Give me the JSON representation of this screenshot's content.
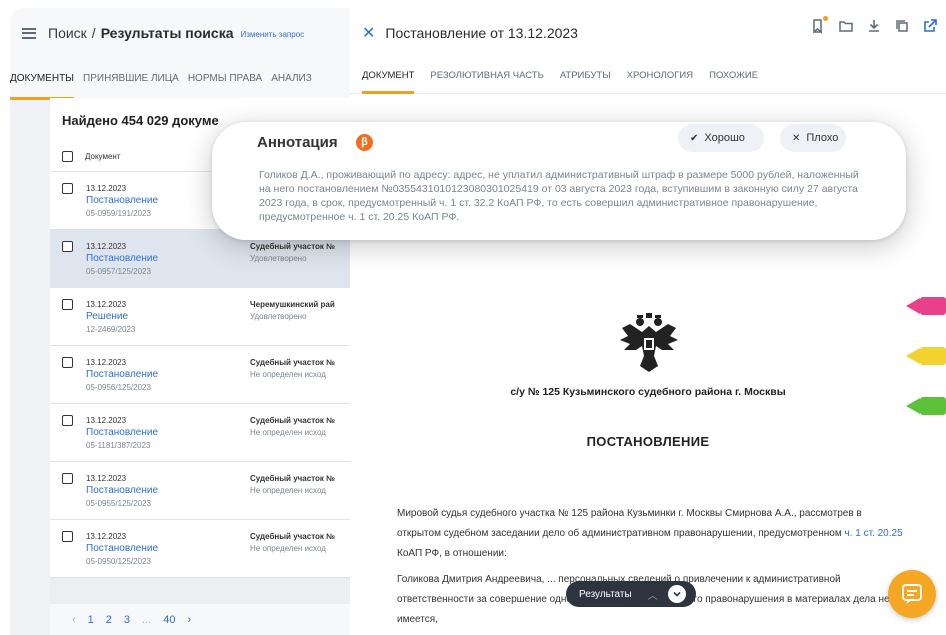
{
  "left": {
    "breadcrumb_root": "Поиск",
    "breadcrumb_sep": "/",
    "breadcrumb_current": "Результаты поиска",
    "change_query": "Изменить запрос",
    "tabs": [
      {
        "label": "ДОКУМЕНТЫ",
        "active": true
      },
      {
        "label": "ПРИНЯВШИЕ ЛИЦА",
        "active": false
      },
      {
        "label": "НОРМЫ ПРАВА",
        "active": false
      },
      {
        "label": "АНАЛИЗ",
        "active": false
      }
    ],
    "found": "Найдено 454 029 докуме",
    "column_document": "Документ",
    "rows": [
      {
        "date": "13.12.2023",
        "type": "Постановление",
        "number": "05-0959/191/2023",
        "court": "",
        "outcome": ""
      },
      {
        "date": "13.12.2023",
        "type": "Постановление",
        "number": "05-0957/125/2023",
        "court": "Судебный участок №",
        "outcome": "Удовлетворено"
      },
      {
        "date": "13.12.2023",
        "type": "Решение",
        "number": "12-2469/2023",
        "court": "Черемушкинский рай",
        "outcome": "Удовлетворено"
      },
      {
        "date": "13.12.2023",
        "type": "Постановление",
        "number": "05-0956/125/2023",
        "court": "Судебный участок №",
        "outcome": "Не определен исход"
      },
      {
        "date": "13.12.2023",
        "type": "Постановление",
        "number": "05-1181/387/2023",
        "court": "Судебный участок №",
        "outcome": "Не определен исход"
      },
      {
        "date": "13.12.2023",
        "type": "Постановление",
        "number": "05-0955/125/2023",
        "court": "Судебный участок №",
        "outcome": "Не определен исход"
      },
      {
        "date": "13.12.2023",
        "type": "Постановление",
        "number": "05-0950/125/2023",
        "court": "Судебный участок №",
        "outcome": "Не определен исход"
      }
    ],
    "pager": {
      "prev": "‹",
      "pages": [
        "1",
        "2",
        "3"
      ],
      "ellipsis": "...",
      "last": "40",
      "next": "›"
    }
  },
  "right": {
    "close_glyph": "✕",
    "title": "Постановление от 13.12.2023",
    "tabs": [
      {
        "label": "ДОКУМЕНТ",
        "active": true
      },
      {
        "label": "РЕЗОЛЮТИВНАЯ ЧАСТЬ",
        "active": false
      },
      {
        "label": "АТРИБУТЫ",
        "active": false
      },
      {
        "label": "ХРОНОЛОГИЯ",
        "active": false
      },
      {
        "label": "ПОХОЖИЕ",
        "active": false
      }
    ],
    "court_line": "с/у № 125 Кузьминского судебного района г. Москвы",
    "heading": "ПОСТАНОВЛЕНИЕ",
    "para1_before": "Мировой судья судебного участка № 125 района Кузьминки г. Москвы Смирнова А.А., рассмотрев в открытом судебном заседании дело об административном правонарушении, предусмотренном ",
    "para1_link": "ч. 1 ст. 20.25",
    "para1_after": " КоАП РФ, в отношении:",
    "para2": "Голикова Дмитрия Андреевича, ... персональных сведений о привлечении к административной ответственности за совершение однородного административного правонарушения в материалах дела не имеется,"
  },
  "annotation": {
    "title": "Аннотация",
    "beta": "β",
    "good_label": "Хорошо",
    "bad_label": "Плохо",
    "text": "Голиков Д.А., проживающий по адресу: адрес, не уплатил административный штраф в размере 5000 рублей, наложенный на него постановлением №0355431010123080301025419 от 03 августа 2023 года, вступившим в законную силу 27 августа 2023 года, в срок, предусмотренный ч. 1 ст. 32.2 КоАП РФ, то есть совершил административное правонарушение, предусмотренное ч. 1 ст. 20.25 КоАП РФ."
  },
  "results_pill": {
    "label": "Результаты"
  },
  "colors": {
    "accent": "#f0a020",
    "link": "#2d6fd6",
    "beta_badge": "#f26d21",
    "chat_button": "#f5a623",
    "marker_pink": "#e8408a",
    "marker_yellow": "#f2d22e",
    "marker_green": "#5cc23a"
  }
}
